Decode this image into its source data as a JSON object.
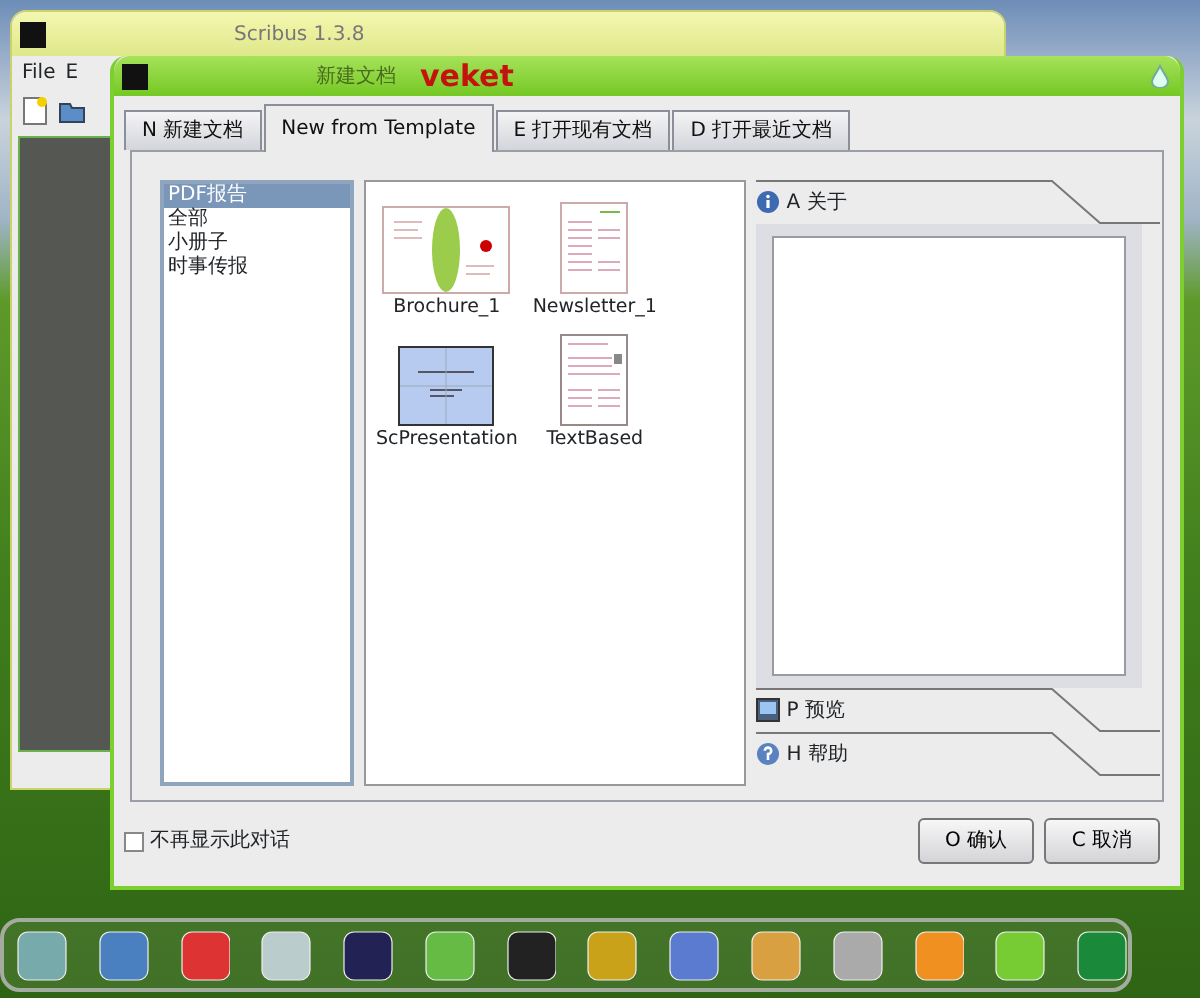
{
  "background_window": {
    "title": "Scribus 1.3.8",
    "menu": [
      "File",
      "E"
    ]
  },
  "dialog": {
    "title": "新建文档",
    "brand": "veket",
    "tabs": [
      {
        "label": "N 新建文档",
        "selected": false
      },
      {
        "label": "New from Template",
        "selected": true
      },
      {
        "label": "E 打开现有文档",
        "selected": false
      },
      {
        "label": "D 打开最近文档",
        "selected": false
      }
    ],
    "categories": [
      {
        "label": "PDF报告",
        "selected": true
      },
      {
        "label": "全部",
        "selected": false
      },
      {
        "label": "小册子",
        "selected": false
      },
      {
        "label": "时事传报",
        "selected": false
      }
    ],
    "templates": [
      {
        "name": "Brochure_1",
        "kind": "brochure"
      },
      {
        "name": "Newsletter_1",
        "kind": "newsletter"
      },
      {
        "name": "ScPresentation",
        "kind": "presentation"
      },
      {
        "name": "TextBased",
        "kind": "textbased"
      }
    ],
    "side_sections": [
      {
        "label": "A 关于",
        "kind": "info",
        "expanded": true
      },
      {
        "label": "P 预览",
        "kind": "preview",
        "expanded": false
      },
      {
        "label": "H 帮助",
        "kind": "help",
        "expanded": false
      }
    ],
    "dont_show_again": {
      "label": "不再显示此对话",
      "checked": false
    },
    "buttons": [
      "O 确认",
      "C 取消"
    ]
  }
}
